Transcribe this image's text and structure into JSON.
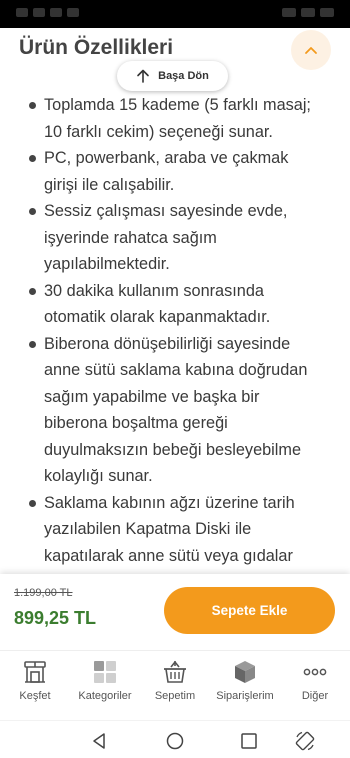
{
  "header": {
    "title": "Ürün Özellikleri"
  },
  "scroll_top_button": {
    "label": "Başa Dön"
  },
  "features": [
    "Toplamda 15 kademe (5 farklı masaj; 10 farklı cekim) seçeneği sunar.",
    "PC, powerbank, araba ve çakmak girişi ile calışabilir.",
    "Sessiz çalışması sayesinde evde, işyerinde rahatca sağım yapılabilmektedir.",
    "30 dakika kullanım sonrasında otomatik olarak kapanmaktadır.",
    "Biberona dönüşebilirliği sayesinde anne sütü saklama kabına doğrudan sağım yapabilme ve başka bir biberona boşaltma gereği duyulmaksızın bebeği besleyebilme kolaylığı sunar.",
    "Saklama kabının ağzı üzerine tarih yazılabilen Kapatma Diski ile kapatılarak anne sütü veya gıdalar"
  ],
  "price": {
    "old": "1.199,00 TL",
    "current": "899,25 TL"
  },
  "cart_button": {
    "label": "Sepete Ekle"
  },
  "tabs": [
    {
      "label": "Keşfet",
      "icon": "store-icon"
    },
    {
      "label": "Kategoriler",
      "icon": "grid-icon"
    },
    {
      "label": "Sepetim",
      "icon": "basket-icon"
    },
    {
      "label": "Siparişlerim",
      "icon": "box-icon"
    },
    {
      "label": "Diğer",
      "icon": "more-icon"
    }
  ],
  "colors": {
    "accent_orange": "#f39a1c",
    "price_green": "#3b7d2f",
    "collapse_bg": "#fdf1e3"
  }
}
